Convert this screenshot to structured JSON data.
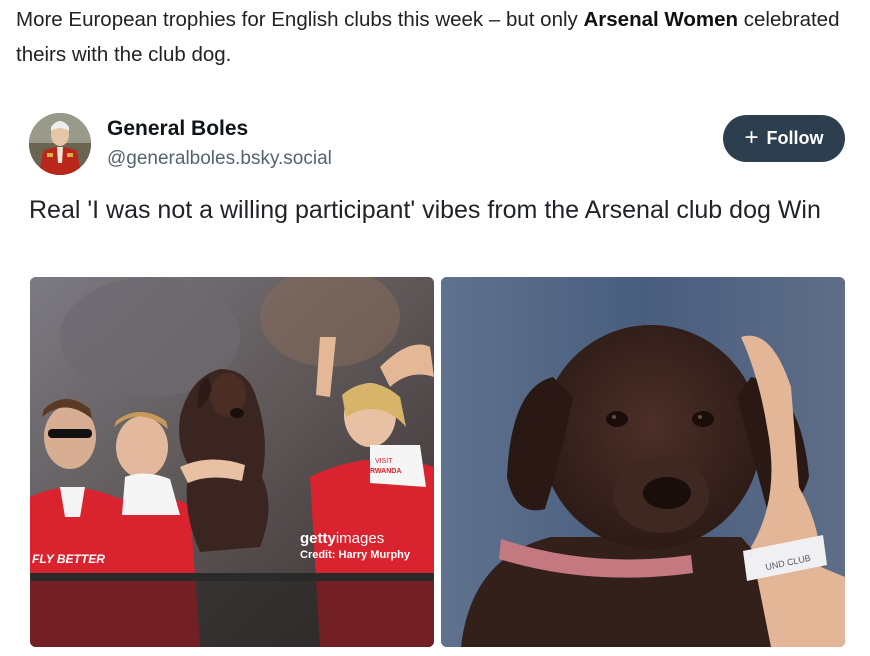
{
  "intro": {
    "before": "More European trophies for English clubs this week – but only ",
    "bold": "Arsenal Women",
    "after": " celebrated theirs with the club dog."
  },
  "post": {
    "author_name": "General Boles",
    "author_handle": "@generalboles.bsky.social",
    "follow_label": "Follow",
    "text": "Real 'I was not a willing participant' vibes from the Arsenal club dog Win"
  },
  "images": {
    "left_getty_brand_bold": "getty",
    "left_getty_brand_regular": "images",
    "left_credit": "Credit: Harry Murphy",
    "left_sign_1": "VISIT",
    "left_sign_2": "RWANDA",
    "left_sign_3": "FLY BETTER",
    "right_band_text": "UND CLUB"
  },
  "colors": {
    "follow_bg": "#2d3e4f",
    "arsenal_red": "#d9232e",
    "dog_brown": "#3b2520"
  }
}
